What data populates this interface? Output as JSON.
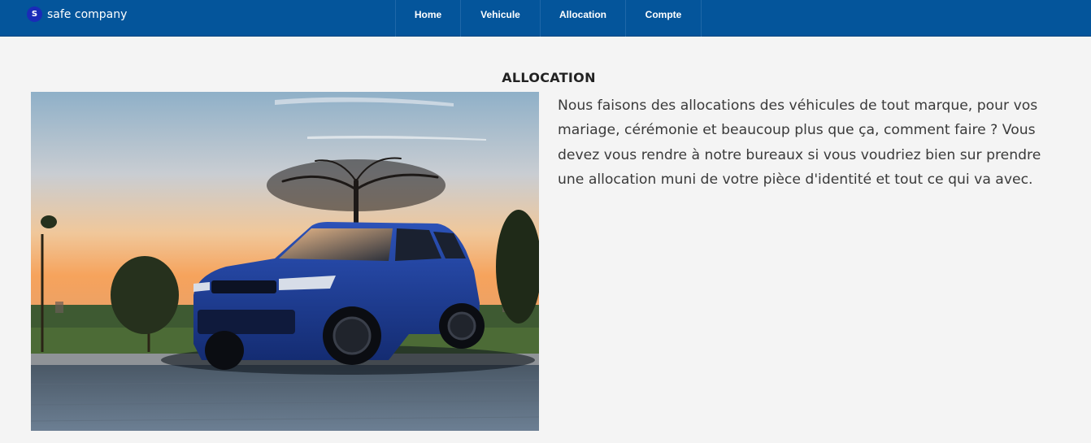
{
  "brand": {
    "badge": "S",
    "name": "safe company"
  },
  "nav": {
    "items": [
      {
        "label": "Home"
      },
      {
        "label": "Vehicule"
      },
      {
        "label": "Allocation"
      },
      {
        "label": "Compte"
      }
    ]
  },
  "main": {
    "title": "ALLOCATION",
    "description": "Nous faisons des allocations des véhicules de tout marque, pour vos mariage, cérémonie et beaucoup plus que ça, comment faire ? Vous devez vous rendre à notre bureaux si vous voudriez bien sur prendre une allocation muni de votre pièce d'identité et tout ce qui va avec."
  },
  "colors": {
    "navbar": "#04559b",
    "brand_badge": "#1a2bb8",
    "page_background": "#f4f4f4",
    "car_body": "#1d3f9a"
  },
  "icons": {
    "brand_logo": "letter-badge-icon"
  }
}
